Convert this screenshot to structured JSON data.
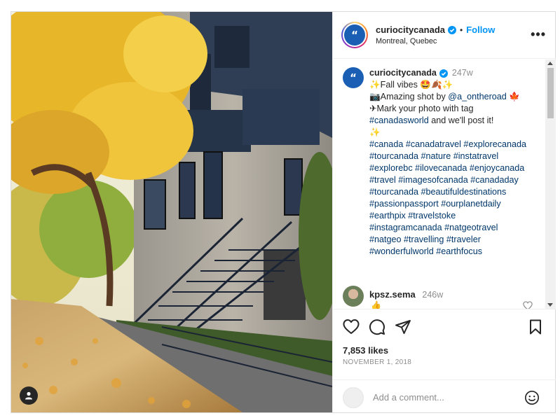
{
  "post": {
    "username": "curiocitycanada",
    "location": "Montreal, Quebec",
    "follow_label": "Follow",
    "separator": "•",
    "more_label": "•••",
    "avatar_glyph": "“",
    "icons": {
      "verified": "verified-badge-icon",
      "more": "more-options-icon",
      "like": "heart-icon",
      "comment": "comment-icon",
      "share": "share-icon",
      "save": "bookmark-icon",
      "tag": "user-tag-icon",
      "emoji": "emoji-icon"
    },
    "colors": {
      "accent": "#0095f6",
      "link": "#00376b",
      "verified": "#0095f6",
      "muted": "#8e8e8e"
    }
  },
  "caption": {
    "username": "curiocitycanada",
    "time": "247w",
    "line1": "✨Fall vibes 🤩🍂✨",
    "line2_prefix": "📷Amazing shot by ",
    "line2_mention": "@a_ontheroad",
    "line2_suffix": " 🍁",
    "line3": "✈Mark your photo with tag",
    "line4_tag": "#canadasworld",
    "line4_suffix": " and we'll post it!",
    "line5": "✨",
    "hashtags": [
      "#canada #canadatravel #explorecanada",
      "#tourcanada #nature #instatravel",
      "#explorebc #ilovecanada #enjoycanada",
      "#travel #imagesofcanada #canadaday",
      "#tourcanada #beautifuldestinations",
      "#passionpassport #ourplanetdaily",
      "#earthpix #travelstoke",
      "#instagramcanada #natgeotravel",
      "#natgeo #travelling #traveler",
      "#wonderfulworld #earthfocus"
    ]
  },
  "first_comment": {
    "username": "kpsz.sema",
    "time": "246w",
    "text": "👍"
  },
  "stats": {
    "likes": "7,853 likes",
    "date": "NOVEMBER 1, 2018"
  },
  "compose": {
    "placeholder": "Add a comment..."
  }
}
